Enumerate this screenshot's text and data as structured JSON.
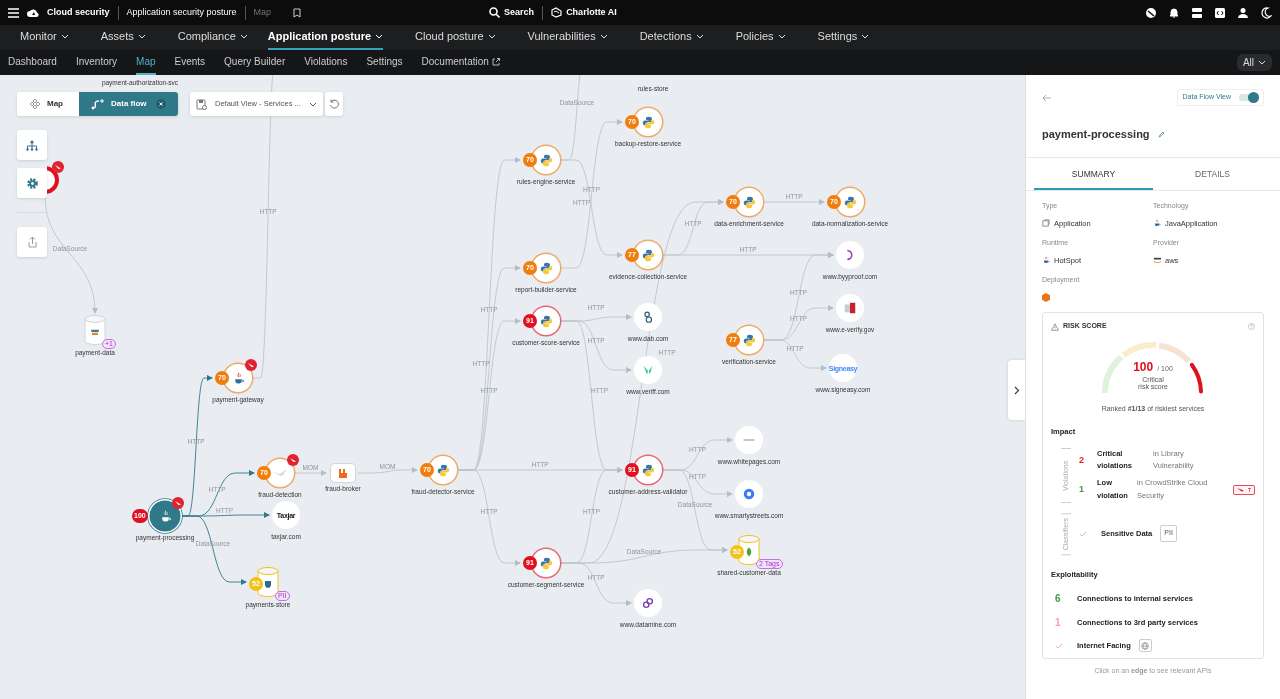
{
  "topbar": {
    "product": "Cloud security",
    "breadcrumbs": [
      "Application security posture",
      "Map"
    ],
    "search": "Search",
    "assistant": "Charlotte AI"
  },
  "nav": [
    {
      "label": "Monitor",
      "selected": false
    },
    {
      "label": "Assets",
      "selected": false
    },
    {
      "label": "Compliance",
      "selected": false
    },
    {
      "label": "Application posture",
      "selected": true
    },
    {
      "label": "Cloud posture",
      "selected": false
    },
    {
      "label": "Vulnerabilities",
      "selected": false
    },
    {
      "label": "Detections",
      "selected": false
    },
    {
      "label": "Policies",
      "selected": false
    },
    {
      "label": "Settings",
      "selected": false
    }
  ],
  "subnav": [
    {
      "label": "Dashboard",
      "selected": false
    },
    {
      "label": "Inventory",
      "selected": false
    },
    {
      "label": "Map",
      "selected": true
    },
    {
      "label": "Events",
      "selected": false
    },
    {
      "label": "Query Builder",
      "selected": false
    },
    {
      "label": "Violations",
      "selected": false
    },
    {
      "label": "Settings",
      "selected": false
    },
    {
      "label": "Documentation",
      "selected": false,
      "external": true
    }
  ],
  "filter": "All",
  "canvas": {
    "mode_tabs": [
      {
        "label": "Map",
        "selected": false
      },
      {
        "label": "Data flow",
        "selected": true
      }
    ],
    "view_select": "Default View - Services ...",
    "clipped_labels": [
      "payment-authorization-svc",
      "rules-store"
    ],
    "nodes": [
      {
        "kind": "service-hidden",
        "color": "#e0111f",
        "flagged": true,
        "selected": false
      },
      {
        "kind": "python",
        "label": "backup-restore-service",
        "score": "70",
        "color": "#f07d0c",
        "flagged": false,
        "selected": false
      },
      {
        "kind": "python",
        "label": "rules-engine-service",
        "score": "70",
        "color": "#f07d0c",
        "flagged": false,
        "selected": false
      },
      {
        "kind": "python",
        "label": "report-builder-service",
        "score": "70",
        "color": "#f07d0c",
        "flagged": false,
        "selected": false
      },
      {
        "kind": "python",
        "label": "customer-score-service",
        "score": "91",
        "color": "#e0111f",
        "flagged": false,
        "selected": false
      },
      {
        "kind": "python",
        "label": "evidence-collection-service",
        "score": "77",
        "color": "#f07d0c",
        "flagged": false,
        "selected": false
      },
      {
        "kind": "python",
        "label": "data-enrichment-service",
        "score": "70",
        "color": "#f07d0c",
        "flagged": false,
        "selected": false
      },
      {
        "kind": "python",
        "label": "data-normalization-service",
        "score": "70",
        "color": "#f07d0c",
        "flagged": false,
        "selected": false
      },
      {
        "kind": "website",
        "label": "www.byyproof.com",
        "flagged": false,
        "selected": false
      },
      {
        "kind": "website",
        "label": "www.dab.com",
        "flagged": false,
        "selected": false
      },
      {
        "kind": "website",
        "label": "www.veriff.com",
        "flagged": false,
        "selected": false
      },
      {
        "kind": "website",
        "label": "www.e-verify.gov",
        "flagged": false,
        "selected": false
      },
      {
        "kind": "python",
        "label": "verification-service",
        "score": "77",
        "color": "#f07d0c",
        "flagged": false,
        "selected": false
      },
      {
        "kind": "website",
        "label": "www.signeasy.com",
        "logo_text": "Signeasy",
        "flagged": false,
        "selected": false
      },
      {
        "kind": "database",
        "label": "payment-data",
        "tag": "+1",
        "flagged": false,
        "selected": false
      },
      {
        "kind": "java",
        "label": "payment-gateway",
        "score": "70",
        "color": "#f07d0c",
        "flagged": true,
        "selected": false
      },
      {
        "kind": "java",
        "label": "payment-processing",
        "score": "100",
        "color": "#e0111f",
        "flagged": true,
        "selected": true
      },
      {
        "kind": "service",
        "label": "fraud-detection",
        "score": "70",
        "color": "#f07d0c",
        "flagged": true,
        "selected": false
      },
      {
        "kind": "broker",
        "label": "fraud-broker",
        "flagged": false,
        "selected": false
      },
      {
        "kind": "python",
        "label": "fraud-detector-service",
        "score": "70",
        "color": "#f07d0c",
        "flagged": false,
        "selected": false
      },
      {
        "kind": "website",
        "label": "taxjar.com",
        "logo_text": "Taxjar",
        "flagged": false,
        "selected": false
      },
      {
        "kind": "database",
        "label": "payments-store",
        "score": "52",
        "color": "#f3c11b",
        "tag": "PII",
        "flagged": false,
        "selected": false
      },
      {
        "kind": "python",
        "label": "customer-address-validator",
        "score": "91",
        "color": "#e0111f",
        "flagged": false,
        "selected": false
      },
      {
        "kind": "website",
        "label": "www.whitepages.com",
        "flagged": false,
        "selected": false
      },
      {
        "kind": "website",
        "label": "www.smartystreets.com",
        "flagged": false,
        "selected": false
      },
      {
        "kind": "database",
        "label": "shared-customer-data",
        "score": "52",
        "color": "#f3c11b",
        "tag": "2 Tags",
        "flagged": false,
        "selected": false
      },
      {
        "kind": "python",
        "label": "customer-segment-service",
        "score": "91",
        "color": "#e0111f",
        "flagged": false,
        "selected": false
      },
      {
        "kind": "website",
        "label": "www.datamine.com",
        "flagged": false,
        "selected": false
      }
    ],
    "edge_labels": [
      "HTTP",
      "DataSource",
      "HTTP",
      "HTTP",
      "HTTP",
      "DataSource",
      "HTTP",
      "HTTP",
      "HTTP",
      "HTTP",
      "HTTP",
      "HTTP",
      "HTTP",
      "HTTP",
      "HTTP",
      "HTTP",
      "HTTP",
      "HTTP",
      "HTTP",
      "MOM",
      "HTTP",
      "HTTP",
      "HTTP",
      "HTTP",
      "HTTP",
      "DataSource",
      "HTTP",
      "MOM",
      "HTTP",
      "DataSource",
      "DataSource",
      "HTTP"
    ]
  },
  "panel": {
    "toggle": {
      "label": "Data Flow View",
      "on": true
    },
    "title": "payment-processing",
    "tabs": [
      {
        "label": "SUMMARY",
        "selected": true
      },
      {
        "label": "DETAILS",
        "selected": false
      }
    ],
    "properties": [
      {
        "label": "Type",
        "value": "Application"
      },
      {
        "label": "Technology",
        "value": "JavaApplication"
      },
      {
        "label": "Runtime",
        "value": "HotSpot"
      },
      {
        "label": "Provider",
        "value": "aws"
      }
    ],
    "deployment_label": "Deployment",
    "risk": {
      "title": "RISK SCORE",
      "score": "100",
      "max": "/ 100",
      "severity": "Critical",
      "caption": "risk score",
      "ranked": "Ranked **#1/13** of riskiest services"
    },
    "impact": {
      "title": "Impact",
      "violations_label": "Violations",
      "violations": [
        {
          "count": "2",
          "color": "#e0252f",
          "title": "Critical violations",
          "source": "in Library Vulnerability",
          "badge": false
        },
        {
          "count": "1",
          "color": "#3d9a4a",
          "title": "Low violation",
          "source": "in CrowdStrike Cloud Security",
          "badge": true
        }
      ],
      "classifiers_label": "Classifiers",
      "classifiers": [
        {
          "label": "Sensitive Data",
          "checked": true,
          "tag": "PII"
        }
      ]
    },
    "exploitability": {
      "title": "Exploitability",
      "items": [
        {
          "kind": "count",
          "value": "6",
          "color": "#3d9a4a",
          "label": "Connections to internal services"
        },
        {
          "kind": "count",
          "value": "1",
          "color": "#f2a0b0",
          "label": "Connections to 3rd party services"
        },
        {
          "kind": "check",
          "checked": true,
          "label": "Internet Facing"
        }
      ]
    },
    "footer": "Click on an **edge** to see relevant APIs"
  }
}
